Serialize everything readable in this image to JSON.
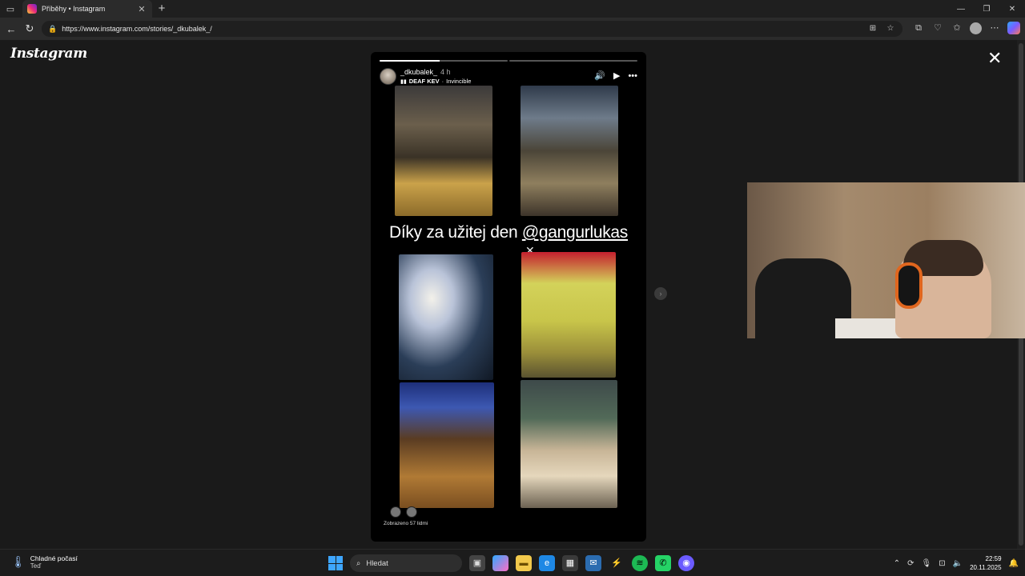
{
  "browser": {
    "tab_title": "Příběhy • Instagram",
    "url": "https://www.instagram.com/stories/_dkubalek_/",
    "new_tab": "+",
    "window_controls": [
      "—",
      "❐",
      "✕"
    ]
  },
  "instagram": {
    "logo": "Instagram",
    "close": "✕"
  },
  "story": {
    "progress": [
      0.47,
      0.0
    ],
    "username": "_dkubalek_",
    "time": "4 h",
    "music_artist": "DEAF KEV",
    "music_separator": " · ",
    "music_track": "Invincible",
    "text_prefix": "Díky za užitej den ",
    "text_mention": "@gangurlukas",
    "seen_by": "Zobrazeno 57 lidmi"
  },
  "taskbar": {
    "weather_title": "Chladné počasí",
    "weather_sub": "Teď",
    "search_placeholder": "Hledat",
    "time": "22:59",
    "date": "20.11.2025"
  },
  "colors": {
    "accent": "#3ea6ff",
    "ig_gradient_start": "#f9ce34",
    "ig_gradient_end": "#6228d7"
  }
}
